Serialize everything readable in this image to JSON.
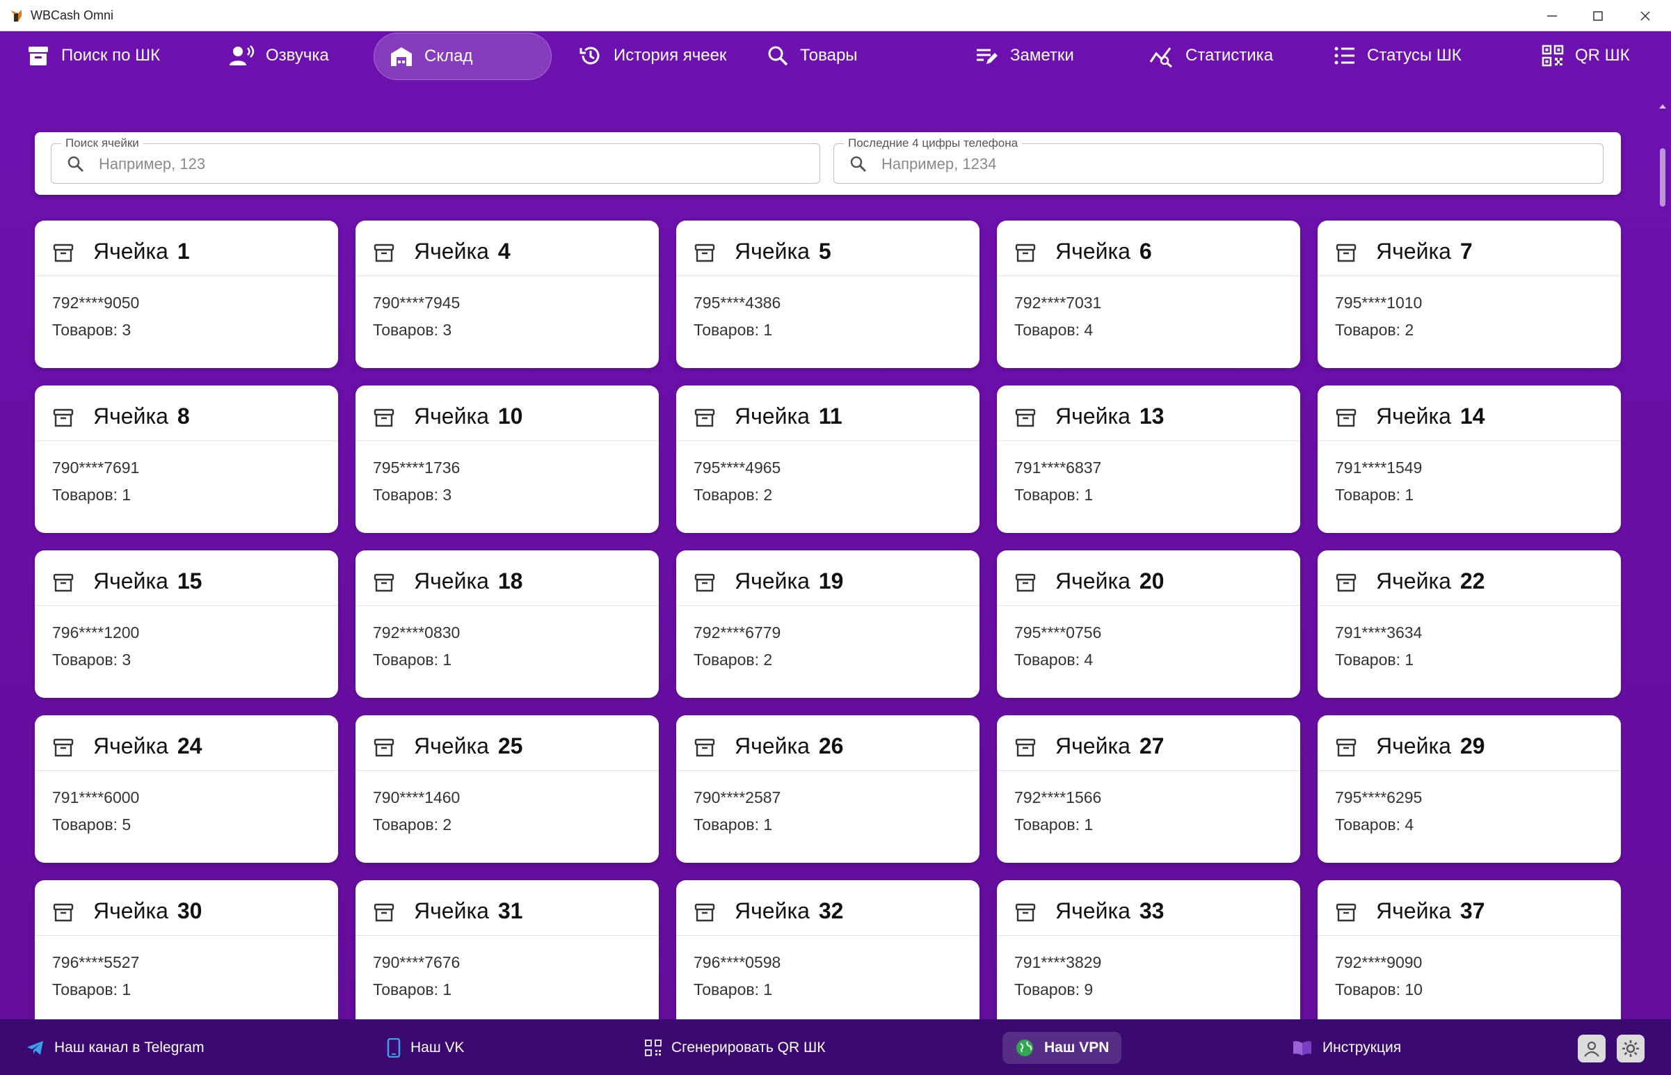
{
  "window": {
    "title": "WBCash Omni"
  },
  "nav": {
    "items": [
      {
        "label": "Поиск по ШК",
        "icon": "archive-icon"
      },
      {
        "label": "Озвучка",
        "icon": "voice-icon"
      },
      {
        "label": "Склад",
        "icon": "warehouse-icon",
        "active": true
      },
      {
        "label": "История ячеек",
        "icon": "history-icon"
      },
      {
        "label": "Товары",
        "icon": "search-icon"
      },
      {
        "label": "Заметки",
        "icon": "notes-icon"
      },
      {
        "label": "Статистика",
        "icon": "stats-icon"
      },
      {
        "label": "Статусы ШК",
        "icon": "list-icon"
      },
      {
        "label": "QR ШК",
        "icon": "qr-icon"
      }
    ]
  },
  "search": {
    "cell_label": "Поиск ячейки",
    "cell_placeholder": "Например, 123",
    "phone_label": "Последние 4 цифры телефона",
    "phone_placeholder": "Например, 1234"
  },
  "cells": [
    {
      "prefix": "Ячейка",
      "num": "1",
      "phone": "792****9050",
      "goods": "Товаров: 3"
    },
    {
      "prefix": "Ячейка",
      "num": "4",
      "phone": "790****7945",
      "goods": "Товаров: 3"
    },
    {
      "prefix": "Ячейка",
      "num": "5",
      "phone": "795****4386",
      "goods": "Товаров: 1"
    },
    {
      "prefix": "Ячейка",
      "num": "6",
      "phone": "792****7031",
      "goods": "Товаров: 4"
    },
    {
      "prefix": "Ячейка",
      "num": "7",
      "phone": "795****1010",
      "goods": "Товаров: 2"
    },
    {
      "prefix": "Ячейка",
      "num": "8",
      "phone": "790****7691",
      "goods": "Товаров: 1"
    },
    {
      "prefix": "Ячейка",
      "num": "10",
      "phone": "795****1736",
      "goods": "Товаров: 3"
    },
    {
      "prefix": "Ячейка",
      "num": "11",
      "phone": "795****4965",
      "goods": "Товаров: 2"
    },
    {
      "prefix": "Ячейка",
      "num": "13",
      "phone": "791****6837",
      "goods": "Товаров: 1"
    },
    {
      "prefix": "Ячейка",
      "num": "14",
      "phone": "791****1549",
      "goods": "Товаров: 1"
    },
    {
      "prefix": "Ячейка",
      "num": "15",
      "phone": "796****1200",
      "goods": "Товаров: 3"
    },
    {
      "prefix": "Ячейка",
      "num": "18",
      "phone": "792****0830",
      "goods": "Товаров: 1"
    },
    {
      "prefix": "Ячейка",
      "num": "19",
      "phone": "792****6779",
      "goods": "Товаров: 2"
    },
    {
      "prefix": "Ячейка",
      "num": "20",
      "phone": "795****0756",
      "goods": "Товаров: 4"
    },
    {
      "prefix": "Ячейка",
      "num": "22",
      "phone": "791****3634",
      "goods": "Товаров: 1"
    },
    {
      "prefix": "Ячейка",
      "num": "24",
      "phone": "791****6000",
      "goods": "Товаров: 5"
    },
    {
      "prefix": "Ячейка",
      "num": "25",
      "phone": "790****1460",
      "goods": "Товаров: 2"
    },
    {
      "prefix": "Ячейка",
      "num": "26",
      "phone": "790****2587",
      "goods": "Товаров: 1"
    },
    {
      "prefix": "Ячейка",
      "num": "27",
      "phone": "792****1566",
      "goods": "Товаров: 1"
    },
    {
      "prefix": "Ячейка",
      "num": "29",
      "phone": "795****6295",
      "goods": "Товаров: 4"
    },
    {
      "prefix": "Ячейка",
      "num": "30",
      "phone": "796****5527",
      "goods": "Товаров: 1"
    },
    {
      "prefix": "Ячейка",
      "num": "31",
      "phone": "790****7676",
      "goods": "Товаров: 1"
    },
    {
      "prefix": "Ячейка",
      "num": "32",
      "phone": "796****0598",
      "goods": "Товаров: 1"
    },
    {
      "prefix": "Ячейка",
      "num": "33",
      "phone": "791****3829",
      "goods": "Товаров: 9"
    },
    {
      "prefix": "Ячейка",
      "num": "37",
      "phone": "792****9090",
      "goods": "Товаров: 10"
    }
  ],
  "footer": {
    "telegram": "Наш канал в Telegram",
    "vk": "Наш VK",
    "qr": "Сгенерировать QR ШК",
    "vpn": "Наш VPN",
    "manual": "Инструкция"
  },
  "colors": {
    "background": "#6a0fa8",
    "footer": "#3a0a70",
    "card": "#ffffff"
  }
}
